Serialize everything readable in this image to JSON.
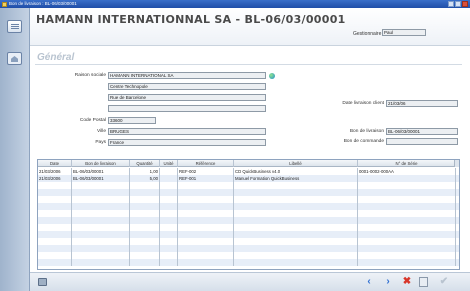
{
  "window": {
    "title": "Bon de livraison : BL-06/03/00001"
  },
  "header": {
    "title": "HAMANN INTERNATIONNAL SA  -  BL-06/03/00001",
    "gestionnaire_label": "Gestionnaire",
    "gestionnaire_value": "Paul"
  },
  "section": {
    "title": "Général"
  },
  "form": {
    "raison_sociale_label": "Raison sociale",
    "raison_sociale": "HAMANN INTERNATIONAL SA",
    "adresse_1": "Centre Technopole",
    "adresse_2": "Rue de Barcelone",
    "adresse_3": "",
    "code_postal_label": "Code Postal",
    "code_postal": "33600",
    "ville_label": "Ville",
    "ville": "BRUGES",
    "pays_label": "Pays",
    "pays": "France",
    "date_livraison_label": "Date livraison client",
    "date_livraison": "21/03/06",
    "bon_livraison_label": "Bon de livraison",
    "bon_livraison": "BL-06/03/00001",
    "bon_commande_label": "Bon de commande",
    "bon_commande": ""
  },
  "grid": {
    "columns": [
      "Date",
      "Bon de livraison",
      "Quantité",
      "Unité",
      "Référence",
      "Libellé",
      "N° de Série"
    ],
    "rows": [
      [
        "21/03/2006",
        "BL-06/03/00001",
        "1,00",
        "",
        "REF-002",
        "CD QuickBusiness v4.0",
        "0001-0002-000AA"
      ],
      [
        "21/03/2006",
        "BL-06/03/00001",
        "5,00",
        "",
        "REF-001",
        "Manuel Formation QuickBusiness",
        ""
      ]
    ]
  },
  "footer": {
    "prev_icon": "‹",
    "next_icon": "›",
    "delete_icon": "✖",
    "ok_icon": "✔"
  }
}
